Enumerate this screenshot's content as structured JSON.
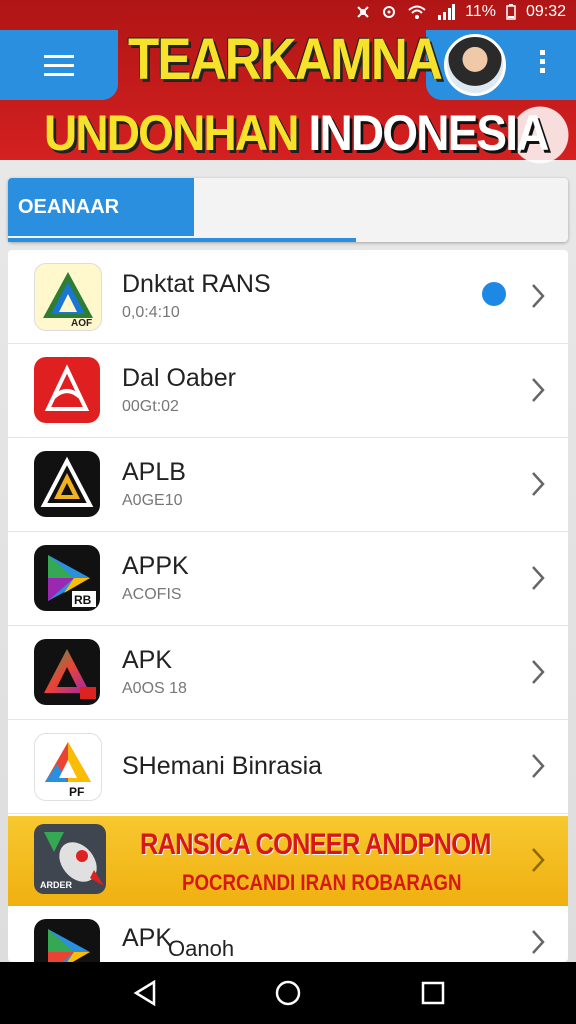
{
  "status_bar": {
    "battery": "11%",
    "time": "09:32"
  },
  "header": {
    "title_line1": "TEARKAMNA",
    "title_line2_a": "UNDONHAN",
    "title_line2_b": "INDONESIA"
  },
  "tabs": {
    "active_label": "OEANAAR"
  },
  "apps": [
    {
      "name": "Dnktat RANS",
      "subtitle": "0,0:4:10",
      "icon": "apk-triangle-icon",
      "badge": true
    },
    {
      "name": "Dal Oaber",
      "subtitle": "00Gt:02",
      "icon": "red-a-logo-icon",
      "badge": false
    },
    {
      "name": "APLB",
      "subtitle": "A0GE10",
      "icon": "gold-a-logo-icon",
      "badge": false
    },
    {
      "name": "APPK",
      "subtitle": "ACOFIS",
      "icon": "play-triangle-icon",
      "badge": false
    },
    {
      "name": "APK",
      "subtitle": "A0OS 18",
      "icon": "gradient-triangle-icon",
      "badge": false
    },
    {
      "name": "SHemani Binrasia",
      "subtitle": "",
      "icon": "pf-triangle-icon",
      "badge": false
    }
  ],
  "promo": {
    "line1": "RANSICA CONEER ANDPNOM",
    "line2": "POCRCANDI IRAN ROBARAGN",
    "icon_label": "ARDER"
  },
  "last_app": {
    "name": "APK",
    "name_overlay": "Oanoh",
    "icon": "google-play-icon"
  },
  "colors": {
    "accent": "#2b8fe0",
    "header_red": "#d42020",
    "title_yellow": "#f6e22a",
    "promo_yellow": "#f5c020"
  }
}
